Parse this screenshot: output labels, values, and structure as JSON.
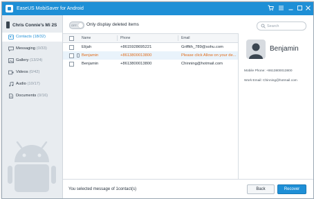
{
  "window": {
    "title": "EaseUS MobiSaver for Android",
    "accent_color": "#1e8fd6",
    "controls": [
      {
        "name": "cart-icon",
        "glyph": "🛒"
      },
      {
        "name": "menu-icon",
        "glyph": "≡"
      },
      {
        "name": "minimize-icon",
        "glyph": "—"
      },
      {
        "name": "maximize-icon",
        "glyph": "□"
      },
      {
        "name": "close-icon",
        "glyph": "✕"
      }
    ]
  },
  "sidebar": {
    "device": "Chris Connie's Mi 2S",
    "items": [
      {
        "label": "Contacts",
        "count": "(18/32)",
        "icon": "contacts-icon",
        "active": true
      },
      {
        "label": "Messaging",
        "count": "(0/33)",
        "icon": "messaging-icon",
        "active": false
      },
      {
        "label": "Gallery",
        "count": "(13/24)",
        "icon": "gallery-icon",
        "active": false
      },
      {
        "label": "Videos",
        "count": "(0/42)",
        "icon": "videos-icon",
        "active": false
      },
      {
        "label": "Audio",
        "count": "(10/17)",
        "icon": "audio-icon",
        "active": false
      },
      {
        "label": "Documents",
        "count": "(0/16)",
        "icon": "documents-icon",
        "active": false
      }
    ]
  },
  "toolbar": {
    "toggle_state": "OFF",
    "toggle_label": "Only display deleted items",
    "search_placeholder": "Search"
  },
  "table": {
    "columns": [
      "Name",
      "Phone",
      "Email"
    ],
    "rows": [
      {
        "name": "Elijah",
        "phone": "+8615928695221",
        "email": "Griffith_789@sohu.com",
        "selected": false,
        "deleted": false
      },
      {
        "name": "Benjamin",
        "phone": "+8613800013800",
        "email": "Please click Allow on your de...",
        "selected": true,
        "deleted": true
      },
      {
        "name": "Benjamin",
        "phone": "+8613800013800",
        "email": "Chinning@hotmail.com",
        "selected": false,
        "deleted": false
      }
    ]
  },
  "detail": {
    "name": "Benjamin",
    "mobile_phone": "Mobile Phone: +8613800013800",
    "work_email": "Work Email: Chinning@hotmail.com"
  },
  "footer": {
    "status": "You selected message of 1contact(s)",
    "back_label": "Back",
    "recover_label": "Recover"
  }
}
